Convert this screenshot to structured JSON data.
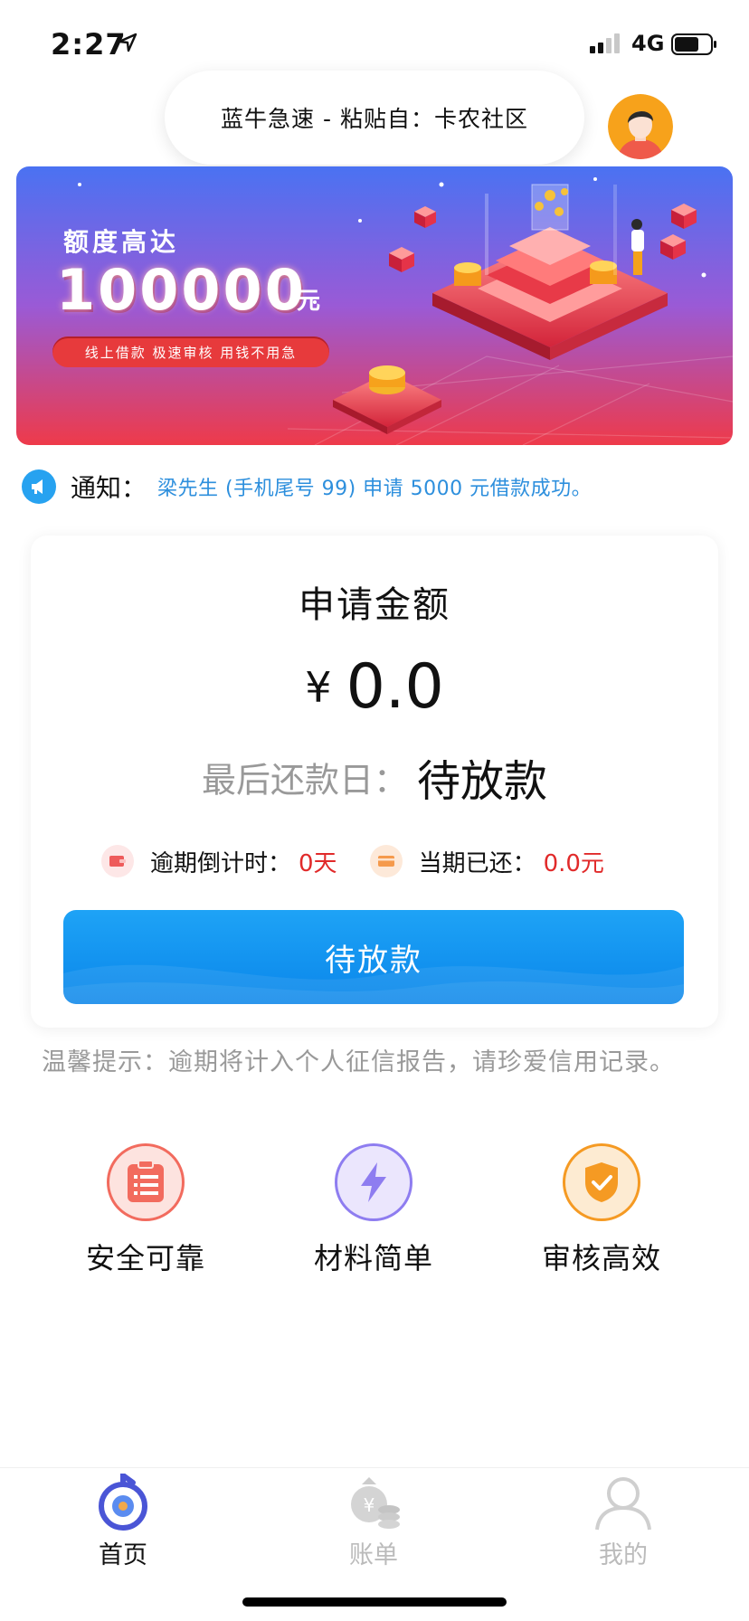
{
  "status_bar": {
    "time": "2:27",
    "network": "4G"
  },
  "paste_banner": {
    "text": "蓝牛急速 - 粘贴自：卡农社区"
  },
  "promo": {
    "title": "额度高达",
    "amount": "100000",
    "unit": "元",
    "tagline": "线上借款  极速审核  用钱不用急"
  },
  "notice": {
    "label": "通知：",
    "text": "梁先生 (手机尾号 99) 申请 5000 元借款成功。"
  },
  "loan_card": {
    "title": "申请金额",
    "currency": "¥",
    "amount": "0.0",
    "due_label": "最后还款日：",
    "due_value": "待放款",
    "overdue_label": "逾期倒计时：",
    "overdue_value": "0天",
    "paid_label": "当期已还：",
    "paid_value": "0.0元",
    "button_label": "待放款"
  },
  "tip": "温馨提示：逾期将计入个人征信报告，请珍爱信用记录。",
  "features": [
    {
      "label": "安全可靠",
      "icon": "clipboard-icon",
      "color": "#f26b5e"
    },
    {
      "label": "材料简单",
      "icon": "lightning-icon",
      "color": "#8e7df0"
    },
    {
      "label": "审核高效",
      "icon": "shield-check-icon",
      "color": "#f59a23"
    }
  ],
  "tabbar": {
    "items": [
      {
        "label": "首页",
        "icon": "home-icon",
        "active": true
      },
      {
        "label": "账单",
        "icon": "bill-icon",
        "active": false
      },
      {
        "label": "我的",
        "icon": "profile-icon",
        "active": false
      }
    ],
    "active_color": "#4a55d6",
    "inactive_color": "#bbbbbb"
  }
}
